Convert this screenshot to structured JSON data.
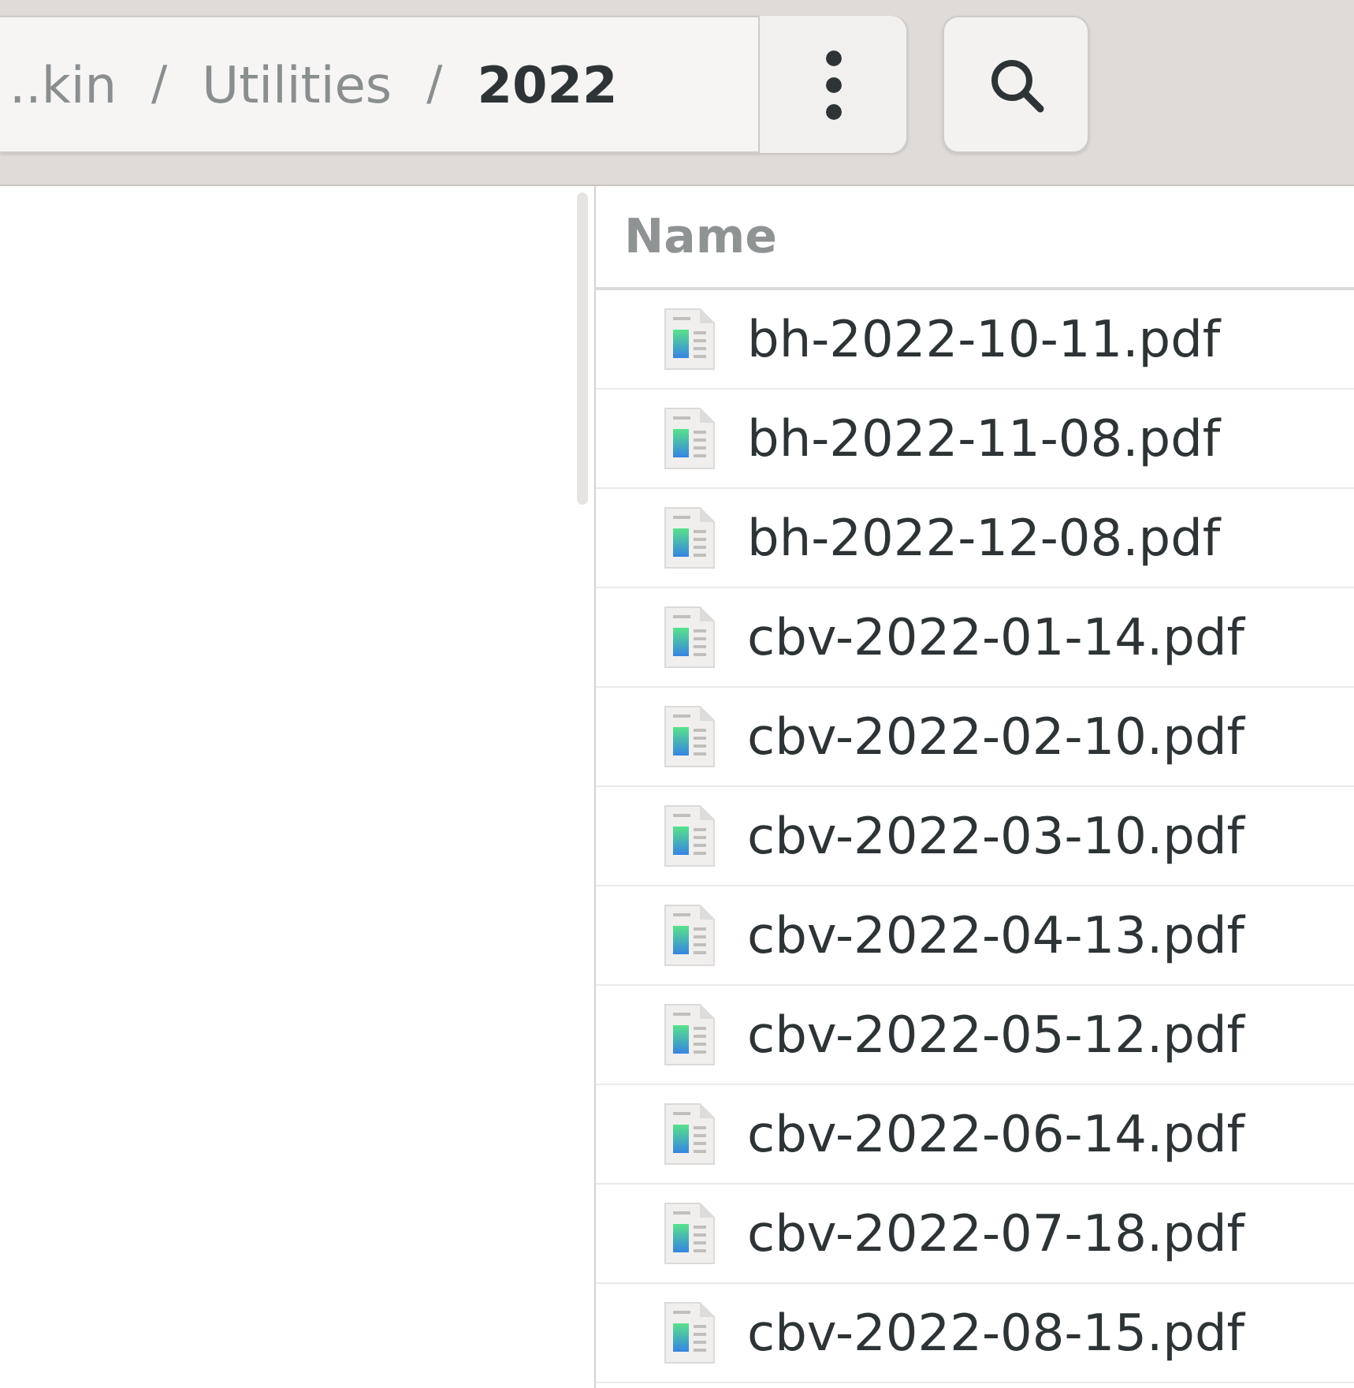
{
  "path_bar": {
    "crumbs": [
      {
        "label": "..kin",
        "current": false
      },
      {
        "label": "Utilities",
        "current": false
      },
      {
        "label": "2022",
        "current": true
      }
    ],
    "separator": "/"
  },
  "file_list": {
    "columns": [
      "Name"
    ],
    "rows": [
      {
        "name": "bh-2022-10-11.pdf"
      },
      {
        "name": "bh-2022-11-08.pdf"
      },
      {
        "name": "bh-2022-12-08.pdf"
      },
      {
        "name": "cbv-2022-01-14.pdf"
      },
      {
        "name": "cbv-2022-02-10.pdf"
      },
      {
        "name": "cbv-2022-03-10.pdf"
      },
      {
        "name": "cbv-2022-04-13.pdf"
      },
      {
        "name": "cbv-2022-05-12.pdf"
      },
      {
        "name": "cbv-2022-06-14.pdf"
      },
      {
        "name": "cbv-2022-07-18.pdf"
      },
      {
        "name": "cbv-2022-08-15.pdf"
      }
    ]
  }
}
